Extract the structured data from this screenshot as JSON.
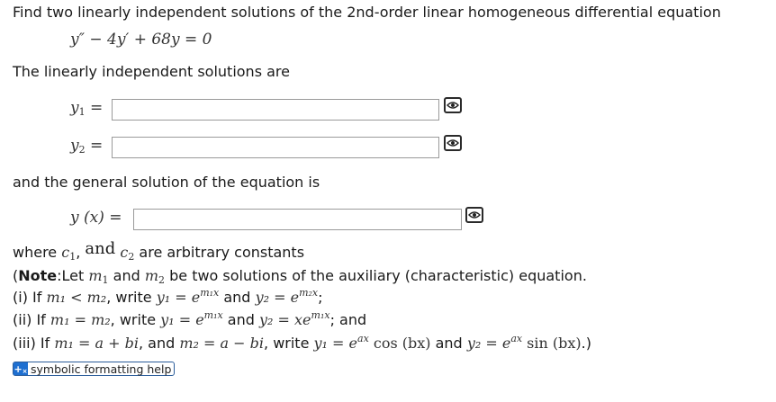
{
  "problem": {
    "prompt": "Find two linearly independent solutions of the 2nd-order linear homogeneous differential equation",
    "equation": "y″ − 4y′ + 68y = 0"
  },
  "solutions": {
    "heading": "The linearly independent solutions are",
    "y1_label": "y",
    "y1_sub": "1",
    "y2_label": "y",
    "y2_sub": "2",
    "equals": "=",
    "y1_value": "",
    "y2_value": ""
  },
  "general": {
    "heading": "and the general solution of the equation is",
    "label": "y (x) =",
    "value": ""
  },
  "constants_line": {
    "where": "where",
    "c1": "c",
    "c1_sub": "1",
    "comma": ",",
    "and": "and",
    "c2": "c",
    "c2_sub": "2",
    "rest": "are arbitrary constants"
  },
  "note": {
    "open": "(",
    "bold": "Note",
    "text1": ":Let",
    "m1": "m",
    "m1_sub": "1",
    "and": "and",
    "m2": "m",
    "m2_sub": "2",
    "text2": "be two solutions of the auxiliary (characteristic) equation.",
    "case_i": {
      "prefix": "(i) If",
      "cond": "m₁ < m₂",
      "write": ", write",
      "y1": "y₁ = e",
      "y1_exp": "m₁x",
      "and": "and",
      "y2": "y₂ = e",
      "y2_exp": "m₂x",
      "end": ";"
    },
    "case_ii": {
      "prefix": "(ii) If",
      "cond": "m₁ = m₂",
      "write": ", write",
      "y1": "y₁ = e",
      "y1_exp": "m₁x",
      "and": "and",
      "y2": "y₂ = xe",
      "y2_exp": "m₁x",
      "end": "; and"
    },
    "case_iii": {
      "prefix": "(iii) If",
      "m1": "m₁ = a + bi",
      "and1": ", and",
      "m2": "m₂ = a − bi",
      "write": ", write",
      "y1": "y₁ = e",
      "y1_exp": "ax",
      "y1_rest": "cos (bx)",
      "and2": "and",
      "y2": "y₂ = e",
      "y2_exp": "ax",
      "y2_rest": "sin (bx)",
      "end": ".)"
    }
  },
  "help_link": {
    "label": "symbolic formatting help",
    "icon": "symbolic-help-icon"
  },
  "colors": {
    "input_border": "#9a9a9a",
    "help_icon_bg": "#1e6fd0",
    "help_border": "#2a5c9a"
  }
}
